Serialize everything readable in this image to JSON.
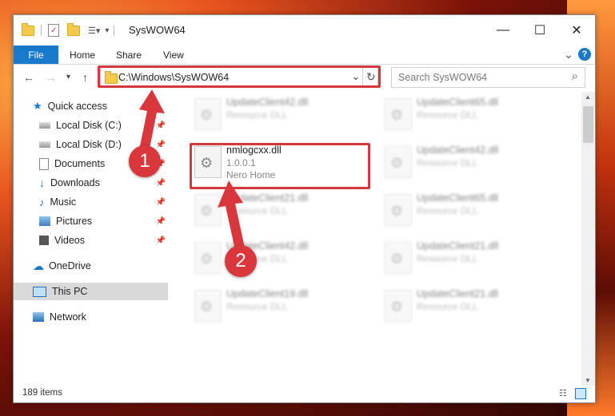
{
  "window": {
    "title": "SysWOW64",
    "minimize": "—",
    "maximize": "☐",
    "close": "✕"
  },
  "ribbon": {
    "tabs": [
      "File",
      "Home",
      "Share",
      "View"
    ],
    "expand": "⌄",
    "help": "?"
  },
  "address": {
    "path": "C:\\Windows\\SysWOW64",
    "dropdown": "⌄",
    "refresh": "↻",
    "search_placeholder": "Search SysWOW64",
    "search_icon": "⌕"
  },
  "sidebar": {
    "items": [
      {
        "label": "Quick access",
        "icon": "star-icon"
      },
      {
        "label": "Local Disk (C:)",
        "icon": "drive-icon"
      },
      {
        "label": "Local Disk (D:)",
        "icon": "drive-icon"
      },
      {
        "label": "Documents",
        "icon": "document-icon"
      },
      {
        "label": "Downloads",
        "icon": "download-icon"
      },
      {
        "label": "Music",
        "icon": "music-icon"
      },
      {
        "label": "Pictures",
        "icon": "pictures-icon"
      },
      {
        "label": "Videos",
        "icon": "videos-icon"
      },
      {
        "label": "OneDrive",
        "icon": "cloud-icon"
      },
      {
        "label": "This PC",
        "icon": "computer-icon"
      },
      {
        "label": "Network",
        "icon": "network-icon"
      }
    ],
    "pin": "📌"
  },
  "files": {
    "highlighted": {
      "name": "nmlogcxx.dll",
      "version": "1.0.0.1",
      "company": "Nero Home"
    },
    "left_column": [
      {
        "name": "UpdateClient42.dll",
        "sub": "Resource DLL"
      },
      {
        "name": "UpdateClient21.dll",
        "sub": "Resource DLL"
      },
      {
        "name": "UpdateClient42.dll",
        "sub": "Resource DLL"
      },
      {
        "name": "UpdateClient19.dll",
        "sub": "Resource DLL"
      }
    ],
    "right_column": [
      {
        "name": "UpdateClient65.dll",
        "sub": "Resource DLL"
      },
      {
        "name": "UpdateClient42.dll",
        "sub": "Resource DLL"
      },
      {
        "name": "UpdateClient65.dll",
        "sub": "Resource DLL"
      },
      {
        "name": "UpdateClient21.dll",
        "sub": "Resource DLL"
      },
      {
        "name": "UpdateClient21.dll",
        "sub": "Resource DLL"
      }
    ]
  },
  "status": {
    "count": "189 items"
  },
  "annotations": {
    "step1": "1",
    "step2": "2"
  },
  "colors": {
    "accent": "#1979ca",
    "highlight": "#d9373b"
  }
}
